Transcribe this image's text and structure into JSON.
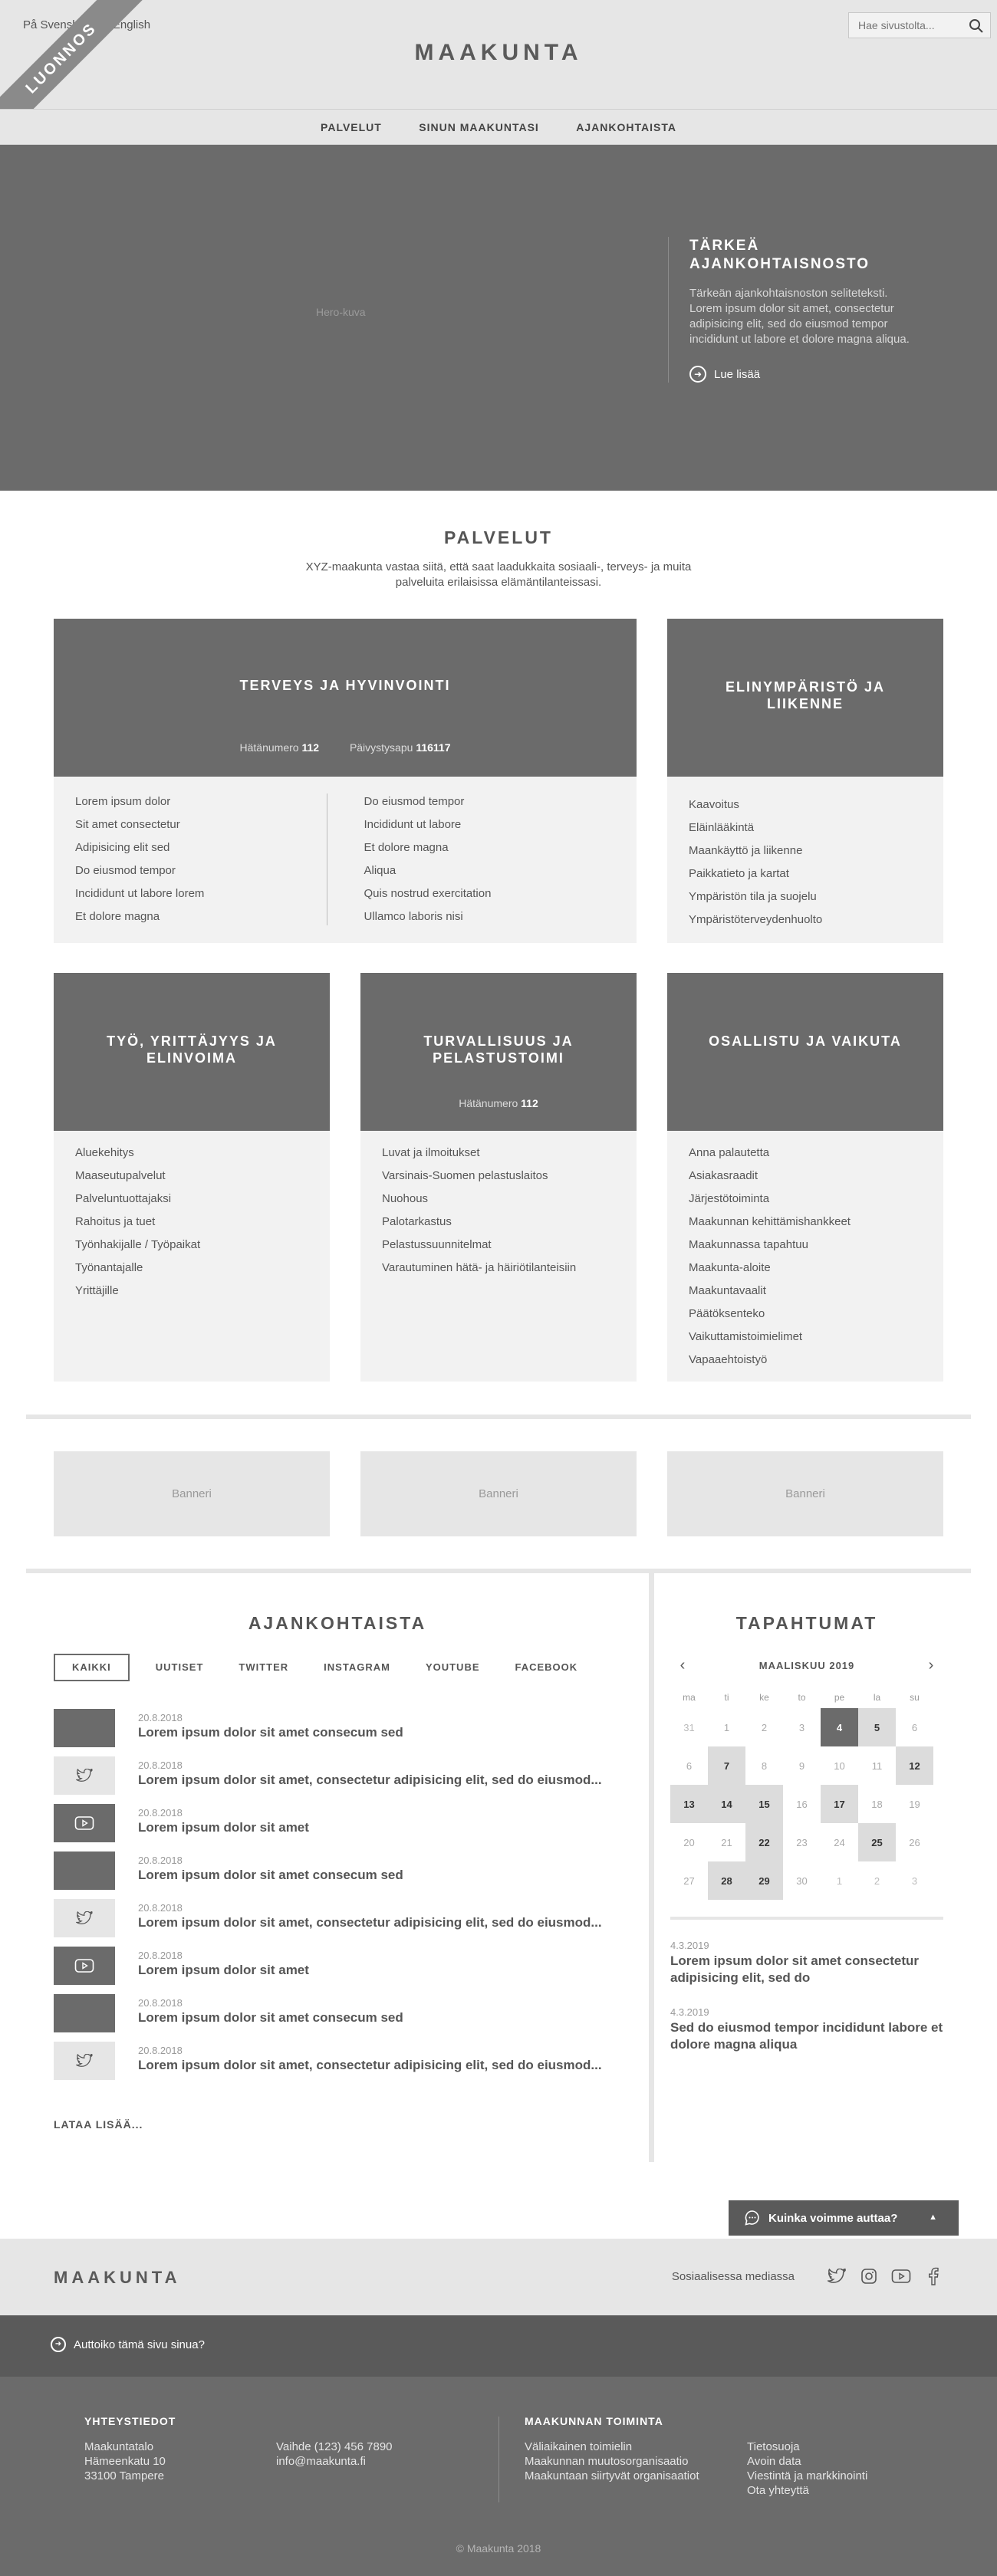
{
  "header": {
    "lang_sv": "På Svenska",
    "lang_sep": "/",
    "lang_en": "In English",
    "ribbon": "LUONNOS",
    "logo": "MAAKUNTA",
    "search_placeholder": "Hae sivustolta..."
  },
  "nav": {
    "items": [
      "PALVELUT",
      "SINUN MAAKUNTASI",
      "AJANKOHTAISTA"
    ]
  },
  "hero": {
    "image_label": "Hero-kuva",
    "news_title": "TÄRKEÄ AJANKOHTAISNOSTO",
    "news_text": "Tärkeän ajankohtaisnoston seliteteksti. Lorem ipsum dolor sit amet, consectetur adipisicing elit, sed do eiusmod tempor incididunt ut labore et dolore magna aliqua.",
    "read_more": "Lue lisää"
  },
  "services": {
    "title": "PALVELUT",
    "lead": "XYZ-maakunta vastaa siitä, että saat laadukkaita sosiaali-, terveys- ja muita palveluita erilaisissa elämäntilanteissasi.",
    "health": {
      "title": "TERVEYS JA HYVINVOINTI",
      "emergency_label": "Hätänumero",
      "emergency_number": "112",
      "duty_label": "Päivystysapu",
      "duty_number": "116117",
      "col1": [
        "Lorem ipsum dolor",
        "Sit amet consectetur",
        "Adipisicing elit sed",
        "Do eiusmod tempor",
        "Incididunt ut labore lorem",
        "Et dolore magna"
      ],
      "col2": [
        "Do eiusmod tempor",
        "Incididunt ut labore",
        "Et dolore magna",
        "Aliqua",
        "Quis nostrud exercitation",
        "Ullamco laboris nisi"
      ]
    },
    "environment": {
      "title": "ELINYMPÄRISTÖ JA LIIKENNE",
      "items": [
        "Kaavoitus",
        "Eläinlääkintä",
        "Maankäyttö ja liikenne",
        "Paikkatieto ja kartat",
        "Ympäristön tila ja suojelu",
        "Ympäristöterveydenhuolto"
      ]
    },
    "work": {
      "title": "TYÖ, YRITTÄJYYS JA ELINVOIMA",
      "items": [
        "Aluekehitys",
        "Maaseutupalvelut",
        "Palveluntuottajaksi",
        "Rahoitus ja tuet",
        "Työnhakijalle / Työpaikat",
        "Työnantajalle",
        "Yrittäjille"
      ]
    },
    "safety": {
      "title": "TURVALLISUUS JA PELASTUSTOIMI",
      "emergency_label": "Hätänumero",
      "emergency_number": "112",
      "items": [
        "Luvat ja ilmoitukset",
        "Varsinais-Suomen pelastuslaitos",
        "Nuohous",
        "Palotarkastus",
        "Pelastussuunnitelmat",
        "Varautuminen hätä- ja häiriötilanteisiin"
      ]
    },
    "participate": {
      "title": "OSALLISTU JA VAIKUTA",
      "items": [
        "Anna palautetta",
        "Asiakasraadit",
        "Järjestötoiminta",
        "Maakunnan kehittämishankkeet",
        "Maakunnassa tapahtuu",
        "Maakunta-aloite",
        "Maakuntavaalit",
        "Päätöksenteko",
        "Vaikuttamistoimielimet",
        "Vapaaehtoistyö"
      ]
    }
  },
  "banners": [
    "Banneri",
    "Banneri",
    "Banneri"
  ],
  "news": {
    "title": "AJANKOHTAISTA",
    "filters": [
      "KAIKKI",
      "UUTISET",
      "TWITTER",
      "INSTAGRAM",
      "YOUTUBE",
      "FACEBOOK"
    ],
    "items": [
      {
        "date": "20.8.2018",
        "headline": "Lorem ipsum dolor sit amet consecum sed",
        "kind": "image"
      },
      {
        "date": "20.8.2018",
        "headline": "Lorem ipsum dolor sit amet, consectetur adipisicing elit, sed do eiusmod...",
        "kind": "twitter"
      },
      {
        "date": "20.8.2018",
        "headline": "Lorem ipsum dolor sit amet",
        "kind": "youtube"
      },
      {
        "date": "20.8.2018",
        "headline": "Lorem ipsum dolor sit amet consecum sed",
        "kind": "image"
      },
      {
        "date": "20.8.2018",
        "headline": "Lorem ipsum dolor sit amet, consectetur adipisicing elit, sed do eiusmod...",
        "kind": "twitter"
      },
      {
        "date": "20.8.2018",
        "headline": "Lorem ipsum dolor sit amet",
        "kind": "youtube"
      },
      {
        "date": "20.8.2018",
        "headline": "Lorem ipsum dolor sit amet consecum sed",
        "kind": "image"
      },
      {
        "date": "20.8.2018",
        "headline": "Lorem ipsum dolor sit amet, consectetur adipisicing elit, sed do eiusmod...",
        "kind": "twitter"
      }
    ],
    "load_more": "LATAA LISÄÄ..."
  },
  "events": {
    "title": "TAPAHTUMAT",
    "month": "MAALISKUU 2019",
    "weekdays": [
      "ma",
      "ti",
      "ke",
      "to",
      "pe",
      "la",
      "su"
    ],
    "days": [
      {
        "n": "31",
        "s": "other"
      },
      {
        "n": "1",
        "s": ""
      },
      {
        "n": "2",
        "s": ""
      },
      {
        "n": "3",
        "s": ""
      },
      {
        "n": "4",
        "s": "sel"
      },
      {
        "n": "5",
        "s": "ev"
      },
      {
        "n": "6",
        "s": ""
      },
      {
        "n": "6",
        "s": ""
      },
      {
        "n": "7",
        "s": "ev"
      },
      {
        "n": "8",
        "s": ""
      },
      {
        "n": "9",
        "s": ""
      },
      {
        "n": "10",
        "s": ""
      },
      {
        "n": "11",
        "s": ""
      },
      {
        "n": "12",
        "s": "ev"
      },
      {
        "n": "13",
        "s": "ev"
      },
      {
        "n": "14",
        "s": "ev"
      },
      {
        "n": "15",
        "s": "ev"
      },
      {
        "n": "16",
        "s": ""
      },
      {
        "n": "17",
        "s": "ev"
      },
      {
        "n": "18",
        "s": ""
      },
      {
        "n": "19",
        "s": ""
      },
      {
        "n": "20",
        "s": ""
      },
      {
        "n": "21",
        "s": ""
      },
      {
        "n": "22",
        "s": "ev"
      },
      {
        "n": "23",
        "s": ""
      },
      {
        "n": "24",
        "s": ""
      },
      {
        "n": "25",
        "s": "ev"
      },
      {
        "n": "26",
        "s": ""
      },
      {
        "n": "27",
        "s": ""
      },
      {
        "n": "28",
        "s": "ev"
      },
      {
        "n": "29",
        "s": "ev"
      },
      {
        "n": "30",
        "s": ""
      },
      {
        "n": "1",
        "s": "other"
      },
      {
        "n": "2",
        "s": "other"
      },
      {
        "n": "3",
        "s": "other"
      }
    ],
    "items": [
      {
        "date": "4.3.2019",
        "title": "Lorem ipsum dolor sit amet consectetur adipisicing elit, sed do"
      },
      {
        "date": "4.3.2019",
        "title": "Sed do eiusmod tempor incididunt labore et dolore magna aliqua"
      }
    ]
  },
  "help_button": "Kuinka voimme auttaa?",
  "footer": {
    "logo": "MAAKUNTA",
    "social_label": "Sosiaalisessa mediassa",
    "social_icons": [
      "twitter-icon",
      "instagram-icon",
      "youtube-icon",
      "facebook-icon"
    ],
    "feedback_question": "Auttoiko tämä sivu sinua?",
    "contact_title": "YHTEYSTIEDOT",
    "address": [
      "Maakuntatalo",
      "Hämeenkatu 10",
      "33100 Tampere"
    ],
    "phone": "Vaihde (123) 456 7890",
    "email": "info@maakunta.fi",
    "functions_title": "MAAKUNNAN TOIMINTA",
    "functions_col1": [
      "Väliaikainen toimielin",
      "Maakunnan muutosorganisaatio",
      "Maakuntaan siirtyvät organisaatiot"
    ],
    "functions_col2": [
      "Tietosuoja",
      "Avoin data",
      "Viestintä ja markkinointi",
      "Ota yhteyttä"
    ],
    "copyright": "© Maakunta 2018"
  },
  "colors": {
    "dark_gray": "#6b6b6b",
    "light_gray": "#e6e6e6",
    "card_gray": "#f2f2f2"
  }
}
